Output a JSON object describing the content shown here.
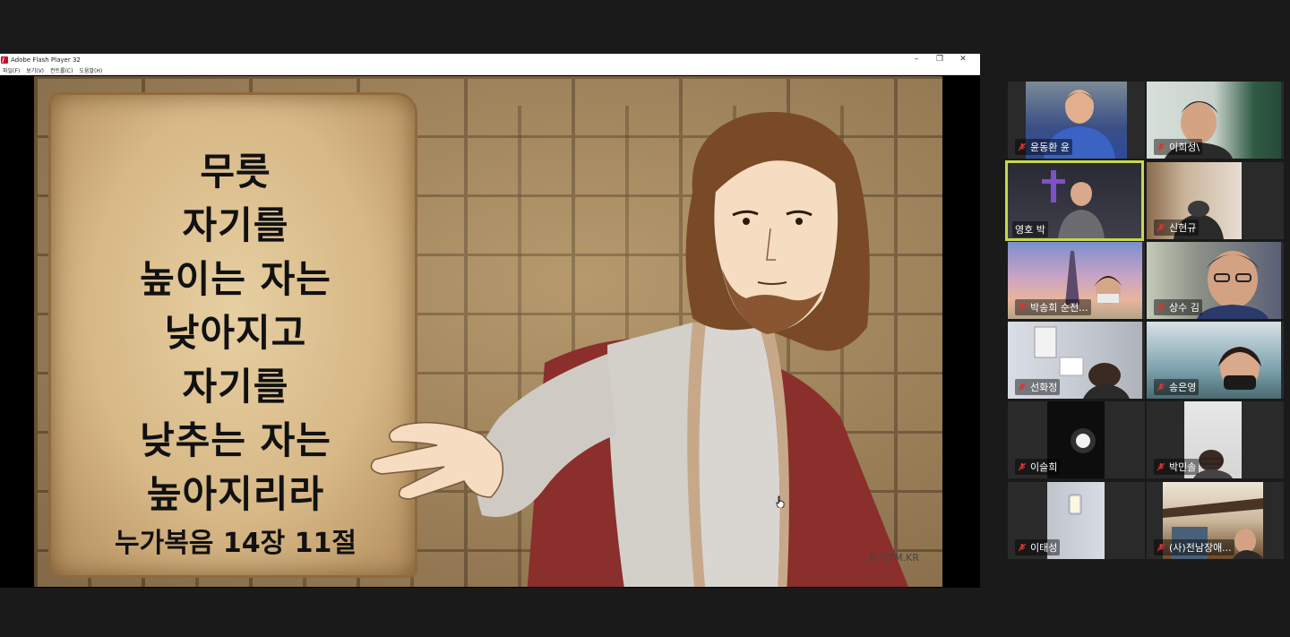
{
  "window": {
    "title": "Adobe Flash Player 32",
    "minimize": "–",
    "restore": "❐",
    "close": "✕"
  },
  "menu": {
    "items": [
      "파일(F)",
      "보기(V)",
      "컨트롤(C)",
      "도움말(H)"
    ]
  },
  "slide": {
    "lines": [
      "무릇",
      "자기를",
      "높이는 자는",
      "낮아지고",
      "자기를",
      "낮추는 자는",
      "높아지리라"
    ],
    "reference": "누가복음 14장 11절",
    "credit": "© CTM.KR"
  },
  "participants": [
    {
      "name": "윤동환 윤",
      "active": false
    },
    {
      "name": "이희성\\",
      "active": false
    },
    {
      "name": "영호 박",
      "active": true
    },
    {
      "name": "신현규",
      "active": false
    },
    {
      "name": "박송희 순전...",
      "active": false
    },
    {
      "name": "상수 김",
      "active": false
    },
    {
      "name": "선화정",
      "active": false
    },
    {
      "name": "송은영",
      "active": false
    },
    {
      "name": "이슬희",
      "active": false
    },
    {
      "name": "박민솔",
      "active": false
    },
    {
      "name": "이태성",
      "active": false
    },
    {
      "name": "(사)전남장애...",
      "active": false
    }
  ],
  "colors": {
    "active_outline": "#c7d84a",
    "mic_muted": "#e0322e"
  }
}
